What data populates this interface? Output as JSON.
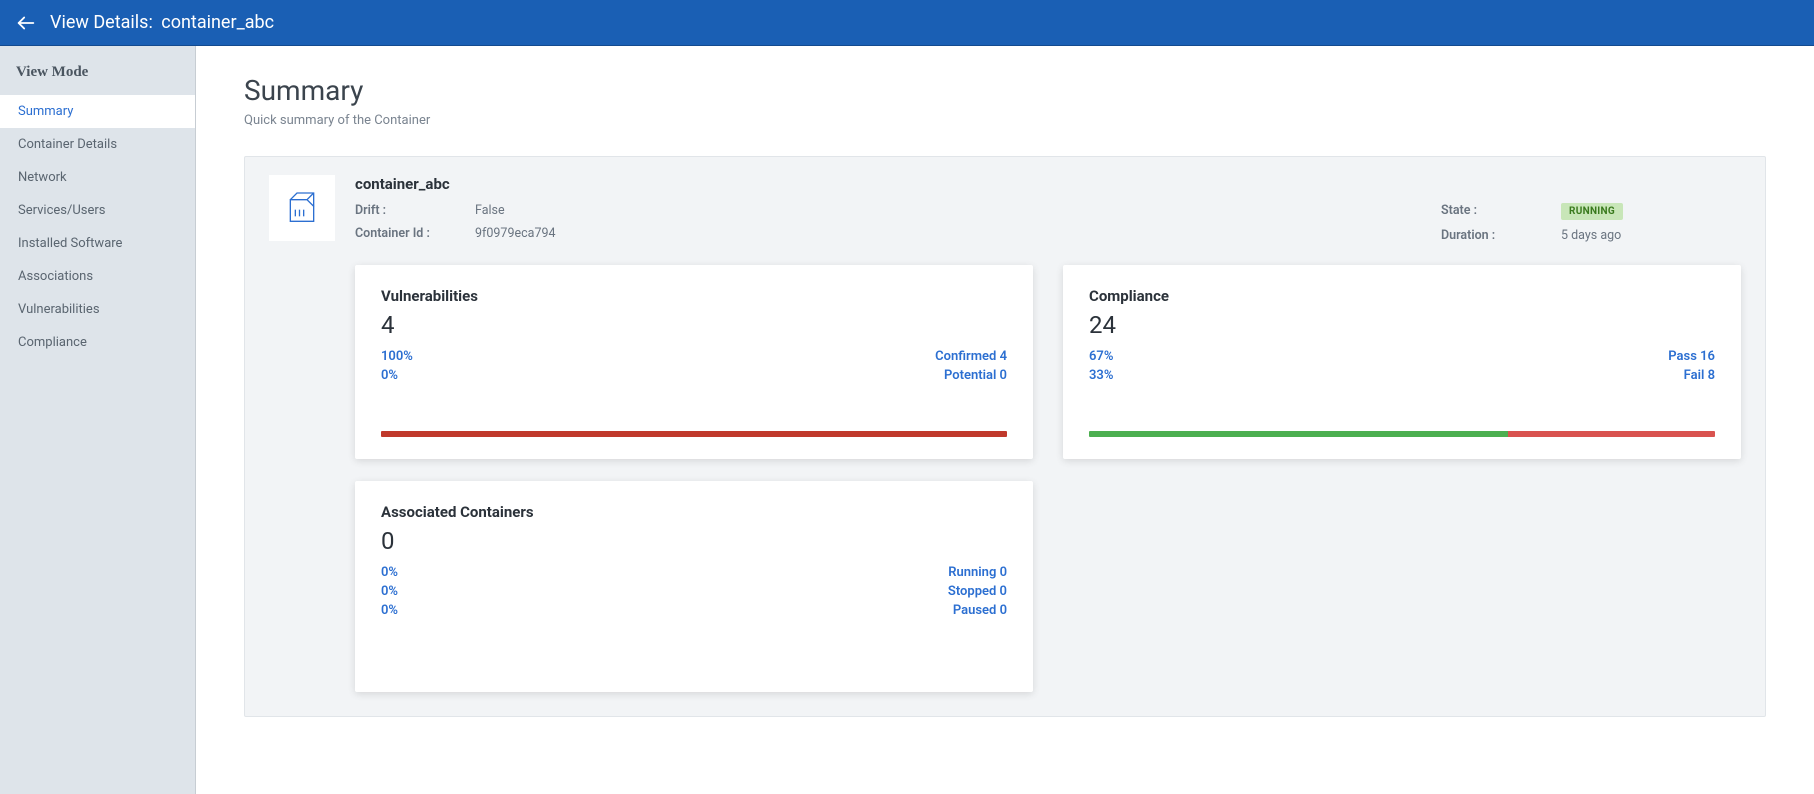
{
  "header": {
    "title_prefix": "View Details:",
    "entity_name": "container_abc"
  },
  "sidebar": {
    "title": "View Mode",
    "items": [
      {
        "label": "Summary",
        "active": true
      },
      {
        "label": "Container Details",
        "active": false
      },
      {
        "label": "Network",
        "active": false
      },
      {
        "label": "Services/Users",
        "active": false
      },
      {
        "label": "Installed Software",
        "active": false
      },
      {
        "label": "Associations",
        "active": false
      },
      {
        "label": "Vulnerabilities",
        "active": false
      },
      {
        "label": "Compliance",
        "active": false
      }
    ]
  },
  "page": {
    "title": "Summary",
    "subtitle": "Quick summary of the Container"
  },
  "entity": {
    "name": "container_abc",
    "meta_left": [
      {
        "label": "Drift :",
        "value": "False"
      },
      {
        "label": "Container Id :",
        "value": "9f0979eca794"
      }
    ],
    "meta_right": [
      {
        "label": "State :",
        "value": "RUNNING",
        "badge": true
      },
      {
        "label": "Duration :",
        "value": "5 days ago"
      }
    ]
  },
  "cards": {
    "vuln": {
      "title": "Vulnerabilities",
      "total": "4",
      "rows": [
        {
          "left": "100%",
          "right": "Confirmed 4"
        },
        {
          "left": "0%",
          "right": "Potential 0"
        }
      ],
      "bar": [
        {
          "color": "seg-red",
          "pct": 100
        }
      ]
    },
    "compliance": {
      "title": "Compliance",
      "total": "24",
      "rows": [
        {
          "left": "67%",
          "right": "Pass 16"
        },
        {
          "left": "33%",
          "right": "Fail 8"
        }
      ],
      "bar": [
        {
          "color": "seg-green",
          "pct": 67
        },
        {
          "color": "seg-red2",
          "pct": 33
        }
      ]
    },
    "assoc": {
      "title": "Associated Containers",
      "total": "0",
      "rows": [
        {
          "left": "0%",
          "right": "Running 0"
        },
        {
          "left": "0%",
          "right": "Stopped 0"
        },
        {
          "left": "0%",
          "right": "Paused 0"
        }
      ]
    }
  }
}
